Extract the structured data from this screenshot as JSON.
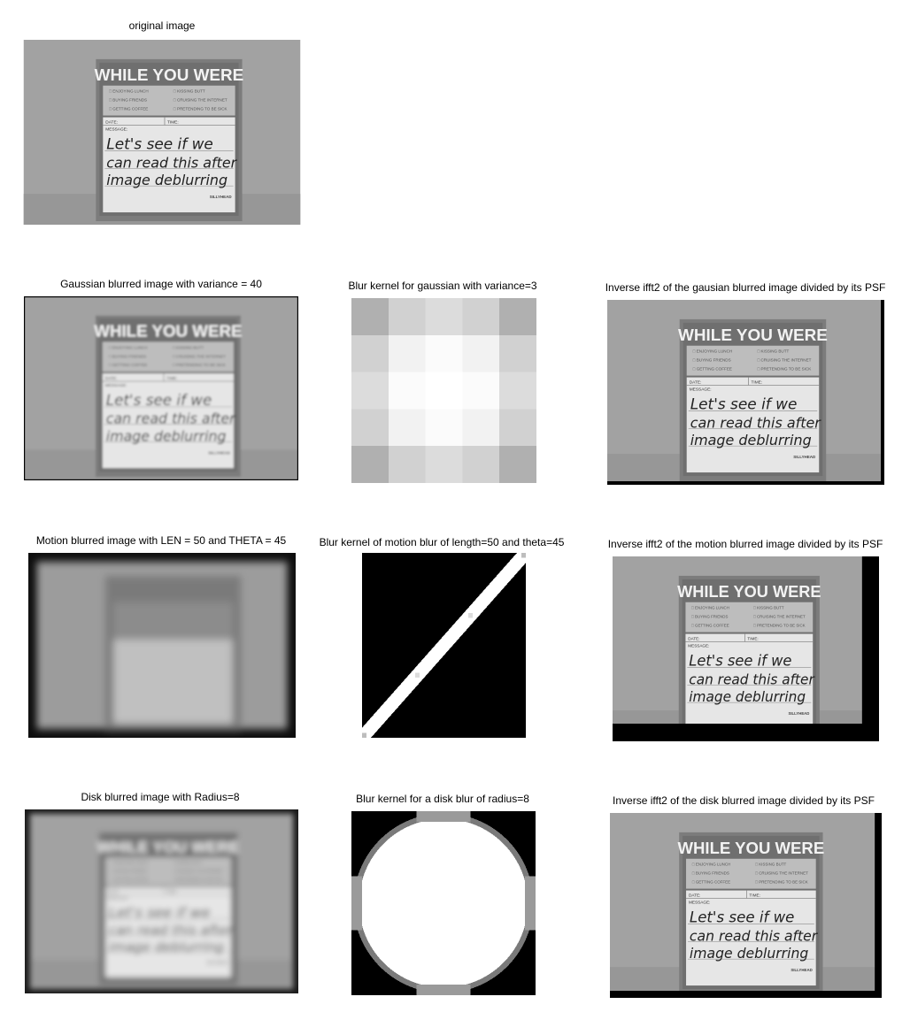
{
  "figure": {
    "row1": {
      "original_title": "original image"
    },
    "row2": {
      "gauss_title": "Gaussian blurred image with variance = 40",
      "kernel_title": "Blur kernel for gaussian with variance=3",
      "inverse_title": "Inverse ifft2 of the gausian blurred image divided by its PSF"
    },
    "row3": {
      "motion_title": "Motion blurred image with LEN = 50 and THETA = 45",
      "kernel_title": "Blur kernel of motion blur of length=50 and theta=45",
      "inverse_title": "Inverse ifft2 of the motion blurred image divided by its PSF"
    },
    "row4": {
      "disk_title": "Disk blurred image with Radius=8",
      "kernel_title": "Blur kernel for a disk blur of radius=8",
      "inverse_title": "Inverse ifft2 of the disk blurred image divided by its PSF"
    }
  },
  "note": {
    "header": "WHILE YOU WERE",
    "options_left": [
      "ENJOYING LUNCH",
      "BUYING FRIENDS",
      "GETTING COFFEE"
    ],
    "options_right": [
      "KISSING BUTT",
      "CRUISING THE INTERNET",
      "PRETENDING TO BE SICK"
    ],
    "date_label": "DATE:",
    "time_label": "TIME:",
    "message_label": "MESSAGE:",
    "handwriting": [
      "Let's see if we",
      "can read this after",
      "image deblurring"
    ],
    "brand": "SILLYHEAD"
  }
}
